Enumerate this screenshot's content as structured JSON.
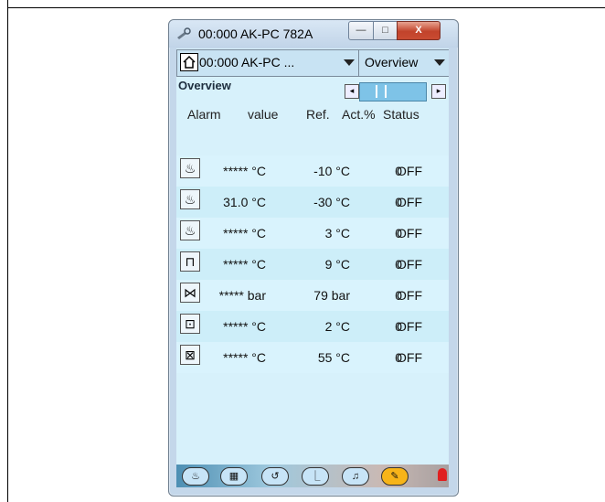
{
  "window": {
    "title": "00:000 AK-PC 782A",
    "min_label": "—",
    "max_label": "□",
    "close_label": "X"
  },
  "toolbar": {
    "device_combo": "00:000 AK-PC ...",
    "view_combo": "Overview"
  },
  "section": {
    "label": "Overview"
  },
  "columns": {
    "alarm": "Alarm",
    "value": "value",
    "ref": "Ref.",
    "act": "Act.%",
    "status": "Status"
  },
  "rows": [
    {
      "icon": "compressor-suction-icon",
      "value": "***** °C",
      "ref": "-10 °C",
      "act": "0",
      "status": "OFF"
    },
    {
      "icon": "compressor-filled-icon",
      "value": "31.0 °C",
      "ref": "-30 °C",
      "act": "0",
      "status": "OFF"
    },
    {
      "icon": "compressor-outline-icon",
      "value": "***** °C",
      "ref": "3 °C",
      "act": "0",
      "status": "OFF"
    },
    {
      "icon": "condenser-icon",
      "value": "***** °C",
      "ref": "9 °C",
      "act": "0",
      "status": "OFF"
    },
    {
      "icon": "receiver-icon",
      "value": "***** bar",
      "ref": "79 bar",
      "act": "0",
      "status": "OFF"
    },
    {
      "icon": "gas-cooler-icon",
      "value": "***** °C",
      "ref": "2 °C",
      "act": "0",
      "status": "OFF"
    },
    {
      "icon": "heat-recovery-icon",
      "value": "***** °C",
      "ref": "55 °C",
      "act": "0",
      "status": "OFF"
    }
  ],
  "colors": {
    "accent": "#7ec3e7",
    "active_tool": "#f7b419",
    "alarm": "#e02020"
  }
}
